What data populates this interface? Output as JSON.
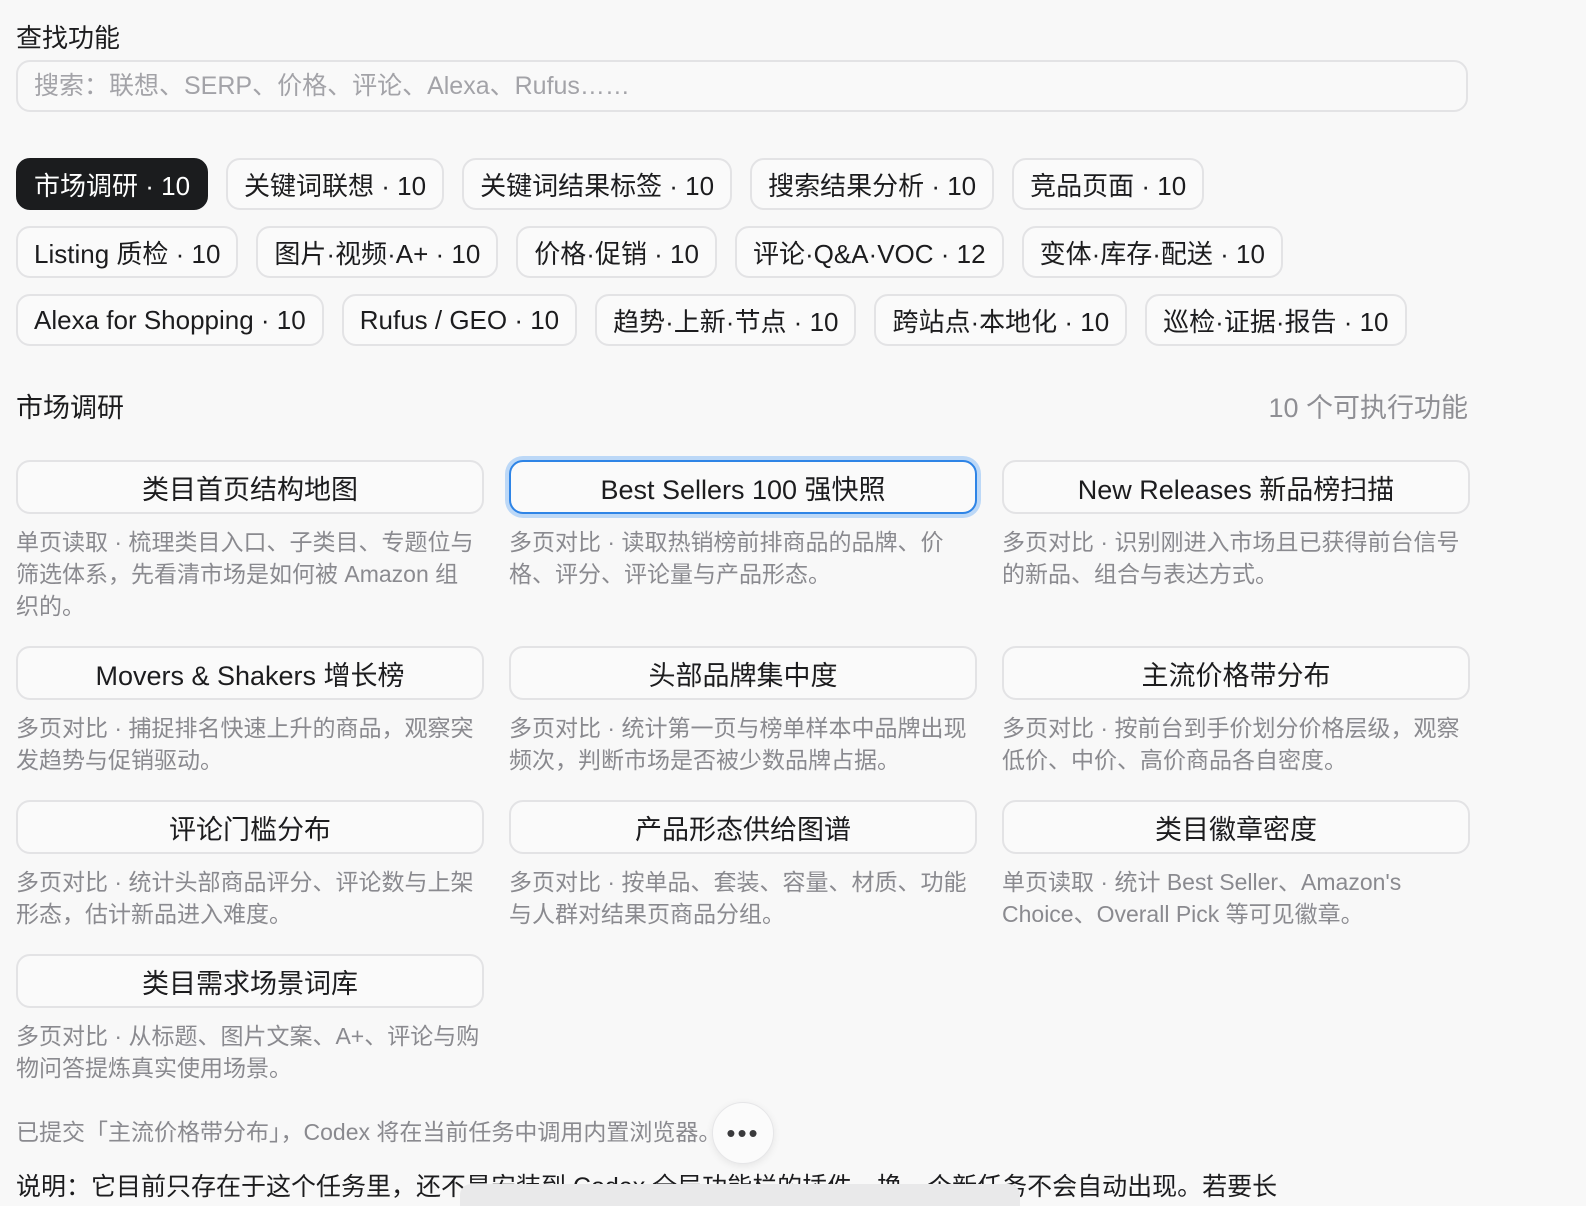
{
  "finder": {
    "title": "查找功能",
    "search_placeholder": "搜索：联想、SERP、价格、评论、Alexa、Rufus……",
    "search_value": ""
  },
  "categories": [
    {
      "label": "市场调研 · 10",
      "active": true
    },
    {
      "label": "关键词联想 · 10"
    },
    {
      "label": "关键词结果标签 · 10"
    },
    {
      "label": "搜索结果分析 · 10"
    },
    {
      "label": "竞品页面 · 10"
    },
    {
      "label": "Listing 质检 · 10"
    },
    {
      "label": "图片·视频·A+ · 10"
    },
    {
      "label": "价格·促销 · 10"
    },
    {
      "label": "评论·Q&A·VOC · 12"
    },
    {
      "label": "变体·库存·配送 · 10"
    },
    {
      "label": "Alexa for Shopping · 10"
    },
    {
      "label": "Rufus / GEO · 10"
    },
    {
      "label": "趋势·上新·节点 · 10"
    },
    {
      "label": "跨站点·本地化 · 10"
    },
    {
      "label": "巡检·证据·报告 · 10"
    }
  ],
  "section": {
    "title": "市场调研",
    "count": "10 个可执行功能"
  },
  "functions": [
    {
      "name": "类目首页结构地图",
      "desc": "单页读取 · 梳理类目入口、子类目、专题位与筛选体系，先看清市场是如何被 Amazon 组织的。"
    },
    {
      "name": "Best Sellers 100 强快照",
      "desc": "多页对比 · 读取热销榜前排商品的品牌、价格、评分、评论量与产品形态。",
      "focused": true
    },
    {
      "name": "New Releases 新品榜扫描",
      "desc": "多页对比 · 识别刚进入市场且已获得前台信号的新品、组合与表达方式。"
    },
    {
      "name": "Movers & Shakers 增长榜",
      "desc": "多页对比 · 捕捉排名快速上升的商品，观察突发趋势与促销驱动。"
    },
    {
      "name": "头部品牌集中度",
      "desc": "多页对比 · 统计第一页与榜单样本中品牌出现频次，判断市场是否被少数品牌占据。"
    },
    {
      "name": "主流价格带分布",
      "desc": "多页对比 · 按前台到手价划分价格层级，观察低价、中价、高价商品各自密度。"
    },
    {
      "name": "评论门槛分布",
      "desc": "多页对比 · 统计头部商品评分、评论数与上架形态，估计新品进入难度。"
    },
    {
      "name": "产品形态供给图谱",
      "desc": "多页对比 · 按单品、套装、容量、材质、功能与人群对结果页商品分组。"
    },
    {
      "name": "类目徽章密度",
      "desc": "单页读取 · 统计 Best Seller、Amazon's Choice、Overall Pick 等可见徽章。"
    },
    {
      "name": "类目需求场景词库",
      "desc": "多页对比 · 从标题、图片文案、A+、评论与购物问答提炼真实使用场景。"
    }
  ],
  "status_message": "已提交「主流价格带分布」，Codex 将在当前任务中调用内置浏览器。",
  "more_button": "•••",
  "note": "说明：它目前只存在于这个任务里，还不是安装到 Codex 全局功能栏的插件。换一个新任务不会自动出现。若要长"
}
